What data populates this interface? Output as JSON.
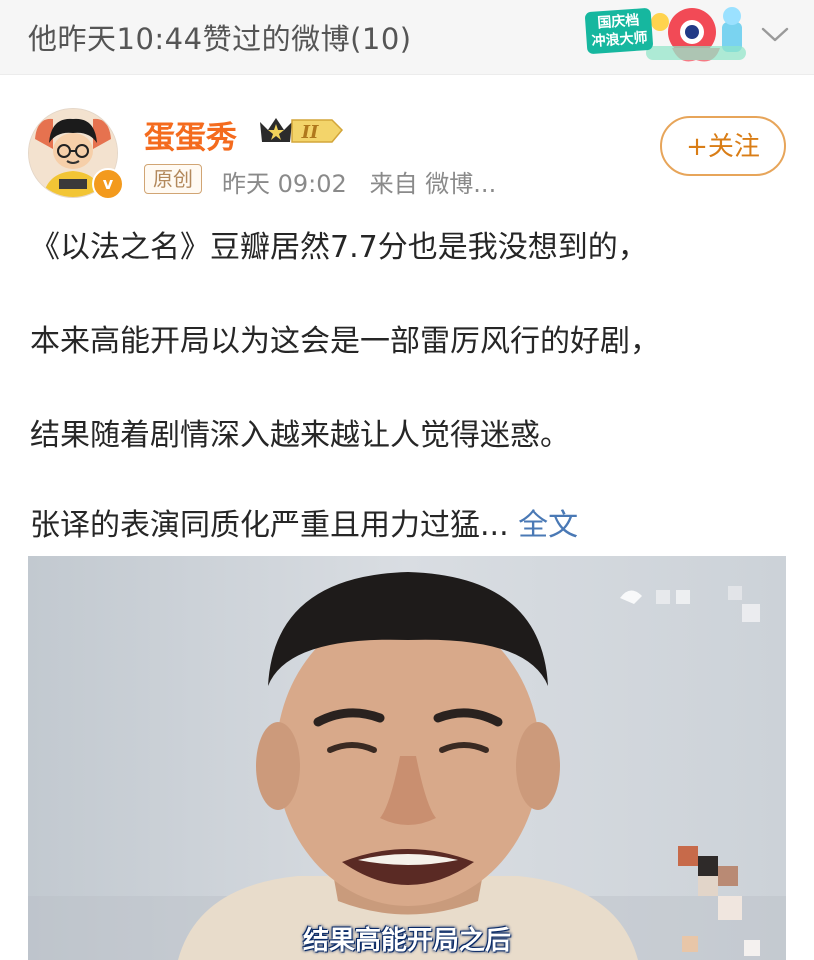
{
  "header": {
    "title": "他昨天10:44赞过的微博(10)",
    "badge_text": "国庆档 冲浪大师",
    "expand_icon": "chevron-down-icon"
  },
  "post": {
    "username": "蛋蛋秀",
    "level": "II",
    "original_tag": "原创",
    "meta": "昨天 09:02   来自 微博...",
    "follow_label": "+关注",
    "lines": [
      "《以法之名》豆瓣居然7.7分也是我没想到的，",
      "本来高能开局以为这会是一部雷厉风行的好剧，",
      "结果随着剧情深入越来越让人觉得迷惑。",
      "张译的表演同质化严重且用力过猛..."
    ],
    "full_text_link": "全文",
    "image": {
      "subtitle": "结果高能开局之后"
    }
  },
  "colors": {
    "username": "#f46b1e",
    "follow": "#d97d16",
    "link": "#4a79b5",
    "header_bg": "#f6f6f6"
  }
}
